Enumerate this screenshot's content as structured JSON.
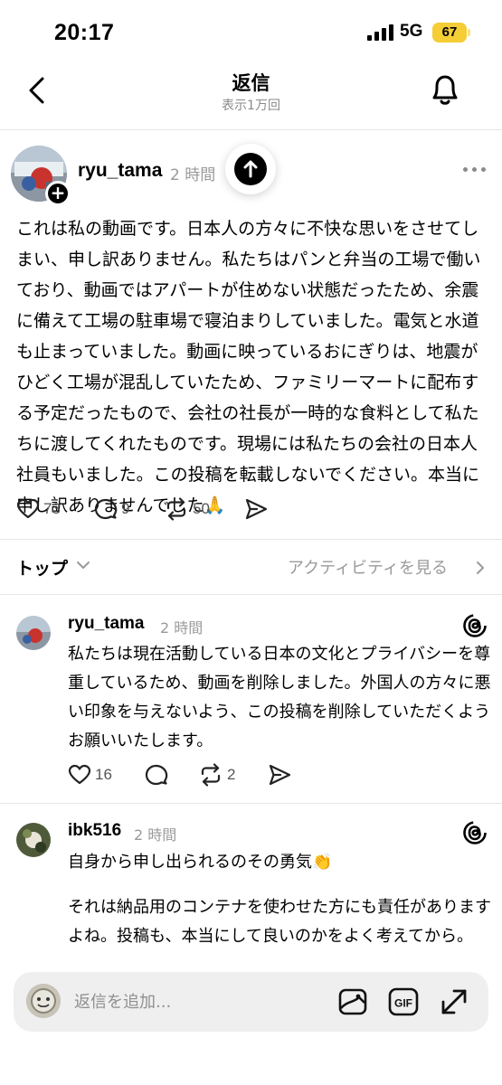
{
  "status_bar": {
    "time": "20:17",
    "network": "5G",
    "battery": "67"
  },
  "nav": {
    "title": "返信",
    "subtitle": "表示1万回"
  },
  "post": {
    "username": "ryu_tama",
    "time": "2 時間",
    "body": "これは私の動画です。日本人の方々に不快な思いをさせてしまい、申し訳ありません。私たちはパンと弁当の工場で働いており、動画ではアパートが住めない状態だったため、余震に備えて工場の駐車場で寝泊まりしていました。電気と水道も止まっていました。動画に映っているおにぎりは、地震がひどく工場が混乱していたため、ファミリーマートに配布する予定だったもので、会社の社長が一時的な食料として私たちに渡してくれたものです。現場には私たちの会社の日本人社員もいました。この投稿を転載しないでください。本当に申し訳ありませんでした🙏",
    "likes": "73",
    "replies": "9",
    "reposts": "50"
  },
  "sort": {
    "label": "トップ",
    "activity_link": "アクティビティを見る"
  },
  "replies": [
    {
      "username": "ryu_tama",
      "time": "2 時間",
      "body": "私たちは現在活動している日本の文化とプライバシーを尊重しているため、動画を削除しました。外国人の方々に悪い印象を与えないよう、この投稿を削除していただくようお願いいたします。",
      "likes": "16",
      "replies": "",
      "reposts": "2"
    },
    {
      "username": "ibk516",
      "time": "2 時間",
      "body_line1": "自身から申し出られるのその勇気👏",
      "body_line2": "それは納品用のコンテナを使わせた方にも責任がありますよね。投稿も、本当にして良いのかをよく考えてから。"
    }
  ],
  "composer": {
    "placeholder": "返信を追加..."
  },
  "icons": {
    "back": "chevron-left-icon",
    "bell": "bell-icon",
    "scroll_up": "arrow-up-icon",
    "more": "more-dots-icon",
    "like": "heart-icon",
    "reply": "comment-icon",
    "repost": "repost-icon",
    "share": "send-icon",
    "threads": "threads-logo-icon",
    "image": "image-icon",
    "gif": "gif-icon",
    "expand": "expand-icon"
  },
  "colors": {
    "battery": "#f5cd34",
    "muted": "#9a9a9a",
    "composer_bg": "#efefef"
  }
}
